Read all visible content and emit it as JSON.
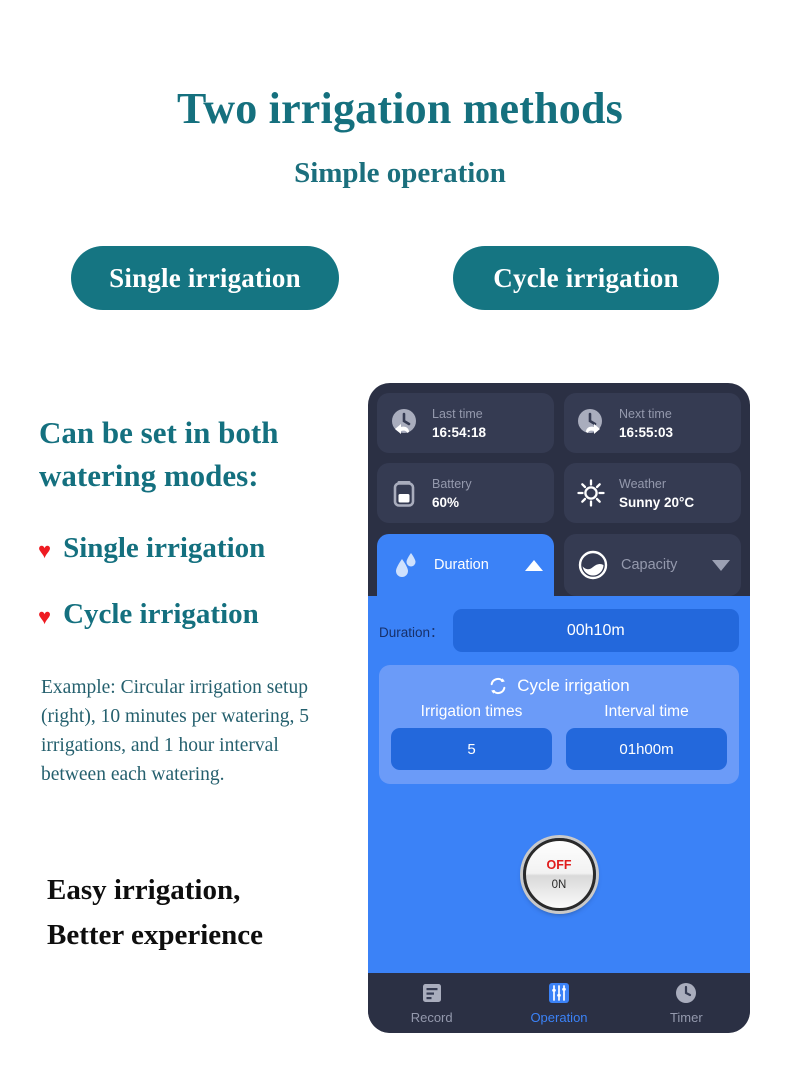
{
  "marketing": {
    "title": "Two irrigation methods",
    "subtitle": "Simple operation",
    "pill_single": "Single irrigation",
    "pill_cycle": "Cycle irrigation",
    "lead": "Can be set in both watering modes:",
    "bullets": [
      {
        "icon": "heart-icon",
        "label": "Single irrigation"
      },
      {
        "icon": "heart-icon",
        "label": "Cycle irrigation"
      }
    ],
    "example": "Example: Circular irrigation setup (right), 10 minutes per watering, 5 irrigations, and 1 hour interval between each watering.",
    "closing_line1": "Easy irrigation,",
    "closing_line2": "Better experience",
    "colors": {
      "teal": "#15707e",
      "pill_bg": "#157582",
      "heart_red": "#ee1b22",
      "black": "#0e0e0e"
    }
  },
  "phone": {
    "stats": [
      {
        "icon": "clock-back-icon",
        "label": "Last time",
        "value": "16:54:18"
      },
      {
        "icon": "clock-forward-icon",
        "label": "Next time",
        "value": "16:55:03"
      },
      {
        "icon": "battery-icon",
        "label": "Battery",
        "value": "60%"
      },
      {
        "icon": "sun-icon",
        "label": "Weather",
        "value": "Sunny 20°C"
      }
    ],
    "tabs": [
      {
        "icon": "water-drops-icon",
        "label": "Duration",
        "arrow": "triangle-up-icon",
        "active": true
      },
      {
        "icon": "capacity-icon",
        "label": "Capacity",
        "arrow": "triangle-down-icon",
        "active": false
      }
    ],
    "duration": {
      "label": "Duration：",
      "value": "00h10m"
    },
    "cycle": {
      "icon": "loop-icon",
      "title": "Cycle irrigation",
      "times_label": "Irrigation times",
      "times_value": "5",
      "interval_label": "Interval time",
      "interval_value": "01h00m"
    },
    "knob": {
      "off_label": "OFF",
      "on_label": "0N"
    },
    "nav": [
      {
        "icon": "record-icon",
        "label": "Record",
        "active": false
      },
      {
        "icon": "sliders-icon",
        "label": "Operation",
        "active": true
      },
      {
        "icon": "clock-icon",
        "label": "Timer",
        "active": false
      }
    ],
    "colors": {
      "bg": "#2b3044",
      "card": "#353b52",
      "accent_blue": "#3b82f7",
      "panel_light": "#6b9bf8",
      "field": "#2368dc",
      "muted_text": "#9499ad"
    }
  }
}
